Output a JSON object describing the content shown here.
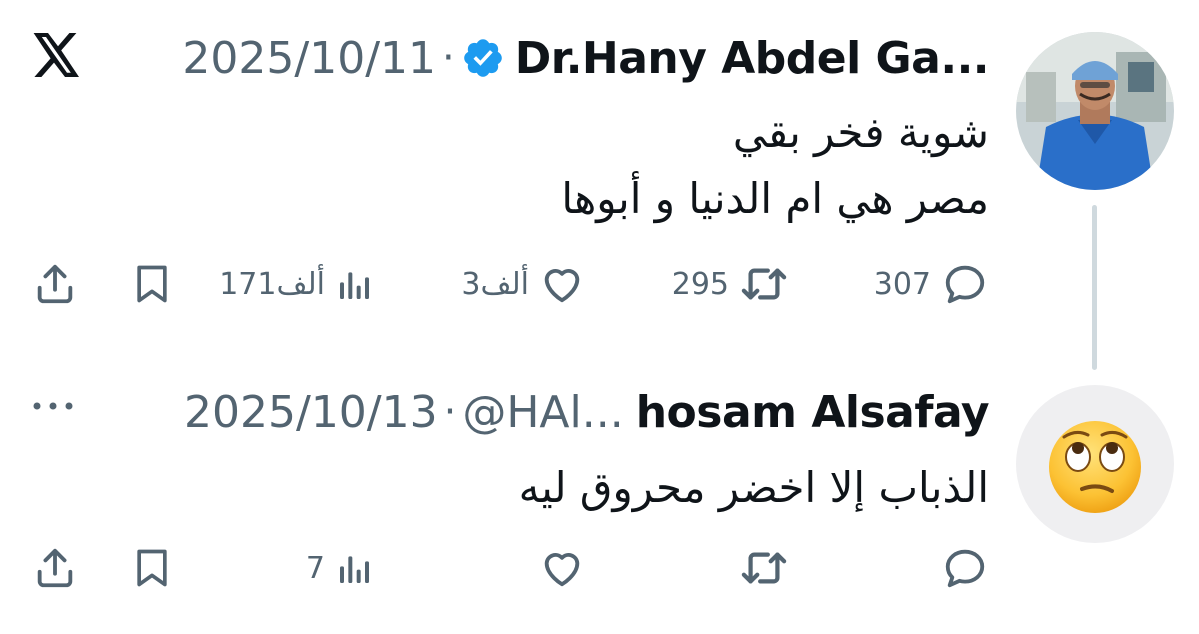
{
  "app": {
    "logo_icon": "x-logo-icon"
  },
  "tweet": {
    "author": "Dr.Hany Abdel Ga...",
    "verified": true,
    "date": "2025/10/11",
    "separator": "·",
    "lines": [
      "شوية فخر بقي",
      "مصر هي ام الدنيا و أبوها"
    ],
    "stats": {
      "replies": "307",
      "reposts": "295",
      "likes": "3ألف",
      "views": "171ألف"
    }
  },
  "reply": {
    "author": "hosam Alsafay",
    "handle": "@HAl...",
    "date": "2025/10/13",
    "separator": "·",
    "avatar_icon": "eye-roll-emoji-icon",
    "lines": [
      "الذباب إلا اخضر محروق ليه"
    ],
    "stats": {
      "replies": "",
      "reposts": "",
      "likes": "",
      "views": "7"
    }
  },
  "colors": {
    "text_primary": "#0f1419",
    "text_secondary": "#536471",
    "verified_blue": "#1d9bf0",
    "thread_line": "#cfd9de"
  }
}
